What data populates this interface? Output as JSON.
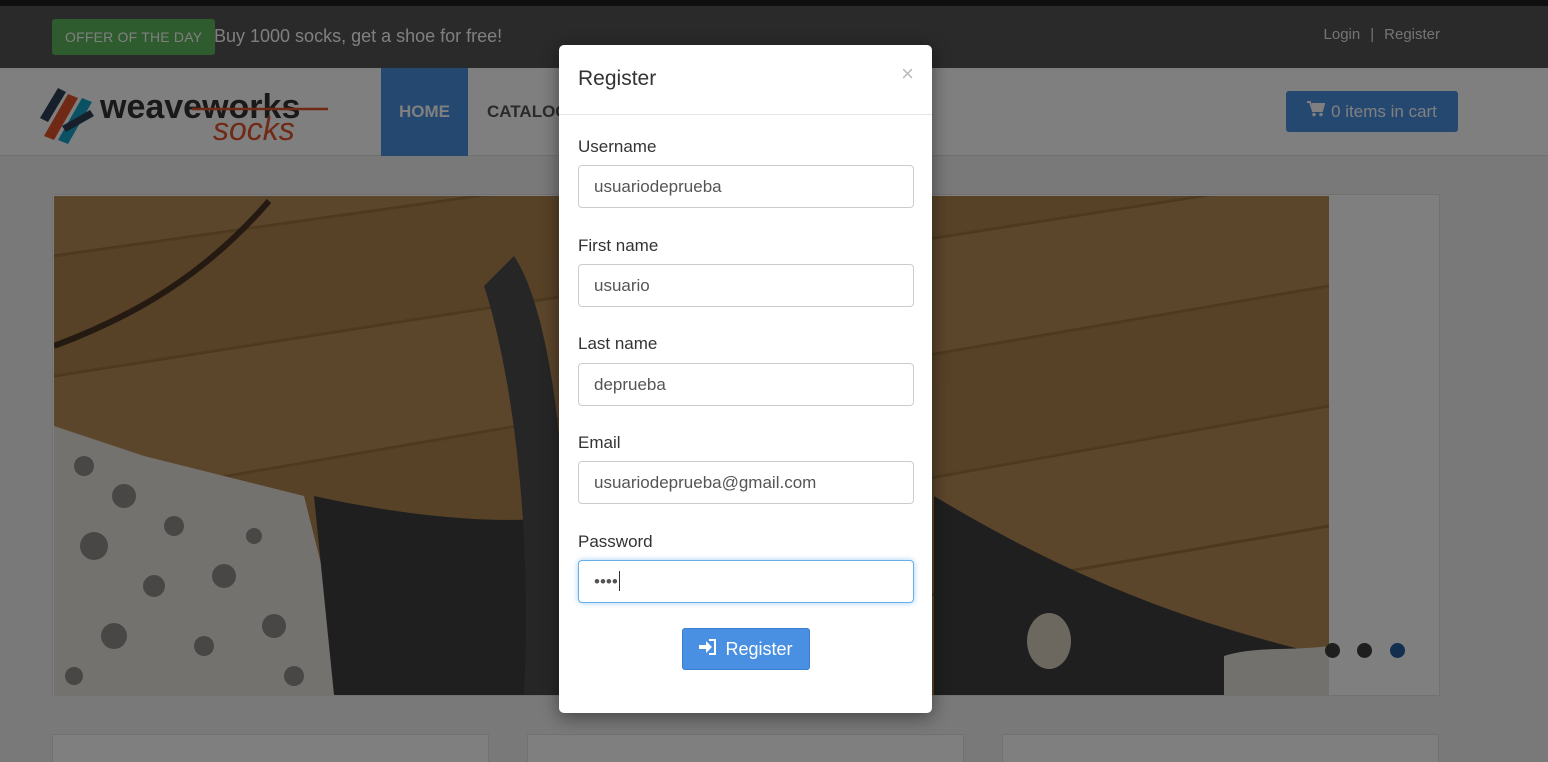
{
  "topbar": {
    "offer_badge": "OFFER OF THE DAY",
    "offer_text": "Buy 1000 socks, get a shoe for free!",
    "login_link": "Login",
    "separator": "|",
    "register_link": "Register"
  },
  "nav": {
    "logo_word1": "weaveworks",
    "logo_word2": "socks",
    "home": "HOME",
    "catalogue": "CATALOG",
    "cart_label": "0 items in cart"
  },
  "slider": {
    "active_dot": 3,
    "dot_count": 3
  },
  "modal": {
    "title": "Register",
    "close": "×",
    "username_label": "Username",
    "username_value": "usuariodeprueba",
    "firstname_label": "First name",
    "firstname_value": "usuario",
    "lastname_label": "Last name",
    "lastname_value": "deprueba",
    "email_label": "Email",
    "email_value": "usuariodeprueba@gmail.com",
    "password_label": "Password",
    "password_value": "••••",
    "submit_label": "Register"
  },
  "colors": {
    "accent": "#4a90e2",
    "offer_green": "#5cb85c",
    "topbar": "#555555"
  }
}
